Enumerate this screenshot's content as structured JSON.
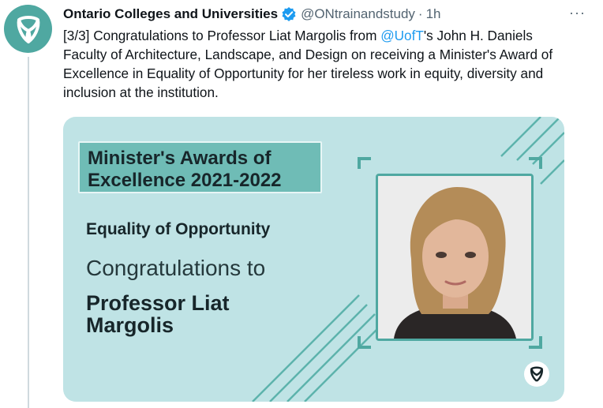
{
  "author": {
    "display_name": "Ontario Colleges and Universities",
    "handle": "@ONtrainandstudy",
    "separator": "·",
    "time": "1h"
  },
  "more_menu_label": "···",
  "tweet": {
    "prefix": "[3/3] Congratulations to Professor Liat Margolis from ",
    "mention": "@UofT",
    "suffix": "'s  John H. Daniels Faculty of Architecture, Landscape, and Design on receiving a Minister's Award of Excellence in Equality of Opportunity for her tireless work in equity, diversity and inclusion at the institution."
  },
  "card": {
    "title_line1": "Minister's Awards of",
    "title_line2": "Excellence 2021-2022",
    "subtitle": "Equality of Opportunity",
    "congrats": "Congratulations to",
    "name_line1": "Professor Liat",
    "name_line2": "Margolis"
  },
  "colors": {
    "accent_blue": "#1d9bf0",
    "card_background": "#bfe3e5",
    "teal": "#4fa8a1"
  },
  "icons": {
    "avatar": "ontario-trillium-logo",
    "verified": "verified-badge-icon",
    "more": "more-horizontal-icon",
    "card_logo": "ontario-trillium-logo"
  }
}
